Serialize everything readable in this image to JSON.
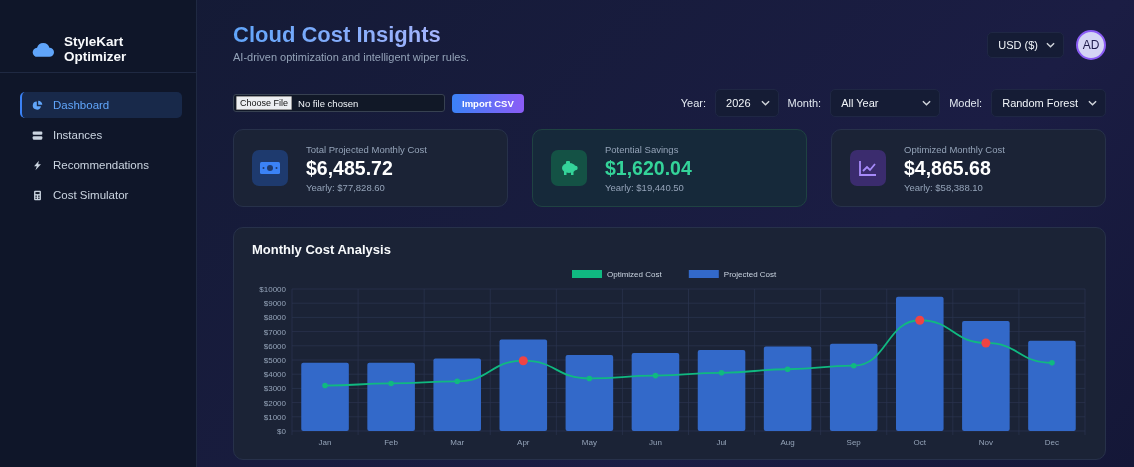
{
  "sidebar": {
    "brand": [
      "StyleKart",
      "Optimizer"
    ],
    "items": [
      {
        "label": "Dashboard",
        "kind": "pie",
        "selected": true
      },
      {
        "label": "Instances",
        "kind": "server",
        "selected": false
      },
      {
        "label": "Recommendations",
        "kind": "bolt",
        "selected": false
      },
      {
        "label": "Cost Simulator",
        "kind": "calculator",
        "selected": false
      }
    ]
  },
  "header": {
    "title": "Cloud Cost Insights",
    "subtitle": "AI-driven optimization and intelligent wiper rules.",
    "currency": "USD ($)",
    "avatar": "AD"
  },
  "import": {
    "choose_button": "Choose File",
    "file_status": "No file chosen",
    "import_button": "Import CSV"
  },
  "filters": [
    {
      "label": "Year:",
      "value": "2026"
    },
    {
      "label": "Month:",
      "value": "All Year"
    },
    {
      "label": "Model:",
      "value": "Random Forest"
    }
  ],
  "stats": [
    {
      "kind": "money",
      "title": "Total Projected Monthly Cost",
      "value": "$6,485.72",
      "yearly": "Yearly: $77,828.60"
    },
    {
      "kind": "savings",
      "title": "Potential Savings",
      "value": "$1,620.04",
      "yearly": "Yearly: $19,440.50"
    },
    {
      "kind": "trend",
      "title": "Optimized Monthly Cost",
      "value": "$4,865.68",
      "yearly": "Yearly: $58,388.10"
    }
  ],
  "chart": {
    "title": "Monthly Cost Analysis",
    "chart_data": {
      "type": "bar",
      "categories": [
        "Jan",
        "Feb",
        "Mar",
        "Apr",
        "May",
        "Jun",
        "Jul",
        "Aug",
        "Sep",
        "Oct",
        "Nov",
        "Dec"
      ],
      "series": [
        {
          "name": "Optimized Cost",
          "color": "#10b981",
          "type": "line",
          "values": [
            3200,
            3350,
            3500,
            4950,
            3700,
            3900,
            4100,
            4350,
            4600,
            7800,
            6200,
            4800
          ]
        },
        {
          "name": "Projected Cost",
          "color": "#3369c9",
          "type": "bar",
          "values": [
            4800,
            4800,
            5100,
            6450,
            5350,
            5500,
            5700,
            5950,
            6150,
            9450,
            7750,
            6350
          ]
        }
      ],
      "ylim": [
        0,
        10000
      ],
      "yticks": [
        {
          "value": 0,
          "label": "$0"
        },
        {
          "value": 1000,
          "label": "$1000"
        },
        {
          "value": 2000,
          "label": "$2000"
        },
        {
          "value": 3000,
          "label": "$3000"
        },
        {
          "value": 4000,
          "label": "$4000"
        },
        {
          "value": 5000,
          "label": "$5000"
        },
        {
          "value": 6000,
          "label": "$6000"
        },
        {
          "value": 7000,
          "label": "$7000"
        },
        {
          "value": 8000,
          "label": "$8000"
        },
        {
          "value": 9000,
          "label": "$9000"
        },
        {
          "value": 10000,
          "label": "$10000"
        }
      ],
      "grid": true,
      "legend": "top"
    },
    "points": [
      {
        "flagged": false
      },
      {
        "flagged": false
      },
      {
        "flagged": false
      },
      {
        "flagged": true
      },
      {
        "flagged": false
      },
      {
        "flagged": false
      },
      {
        "flagged": false
      },
      {
        "flagged": false
      },
      {
        "flagged": false
      },
      {
        "flagged": true
      },
      {
        "flagged": true
      },
      {
        "flagged": false
      }
    ]
  }
}
